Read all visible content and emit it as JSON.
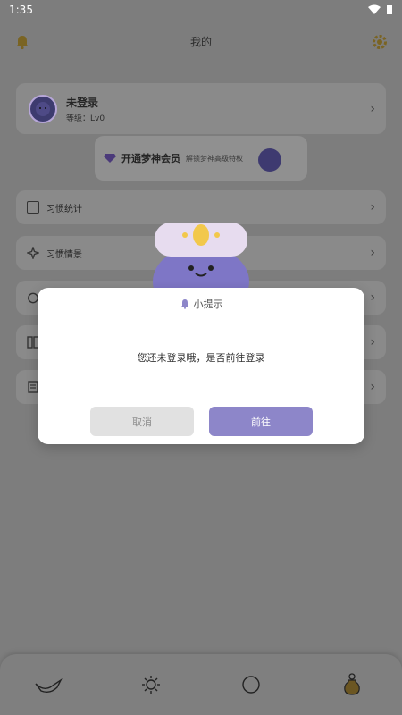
{
  "status_bar": {
    "time": "1:35"
  },
  "header": {
    "title": "我的"
  },
  "profile": {
    "name": "未登录",
    "level": "等级：Lv0"
  },
  "vip": {
    "title": "开通梦神会员",
    "subtitle": "解锁梦神高级特权"
  },
  "menu": [
    {
      "label": "习惯统计"
    },
    {
      "label": "习惯情景"
    }
  ],
  "dialog": {
    "title": "小提示",
    "message": "您还未登录哦，是否前往登录",
    "cancel_label": "取消",
    "confirm_label": "前往"
  },
  "colors": {
    "overlay": "#7d7d7d",
    "primary": "#8d86c9",
    "cancel_bg": "#e1e1e1"
  },
  "tabs": [
    {
      "icon": "magic-lamp-icon"
    },
    {
      "icon": "sun-icon"
    },
    {
      "icon": "circle-icon"
    },
    {
      "icon": "potion-icon"
    }
  ]
}
